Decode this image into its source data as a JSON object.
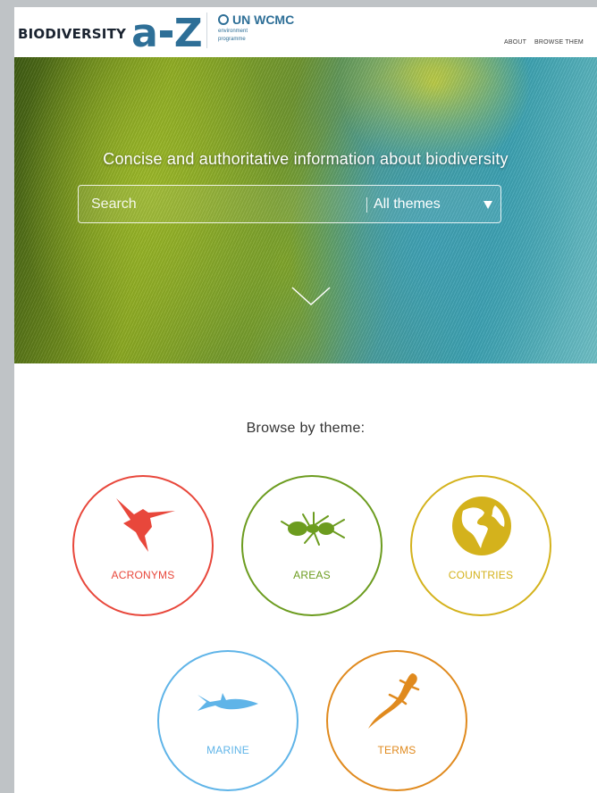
{
  "header": {
    "logo_text": "BIODIVERSITY",
    "logo_a": "a",
    "logo_z": "Z",
    "partner_name": "UN WCMC",
    "partner_sub1": "environment",
    "partner_sub2": "programme",
    "nav": [
      {
        "label": "ABOUT"
      },
      {
        "label": "BROWSE THEM"
      }
    ]
  },
  "hero": {
    "title": "Concise and authoritative information about biodiversity",
    "search": {
      "placeholder": "Search",
      "value": ""
    },
    "theme_select": {
      "selected": "All themes"
    }
  },
  "browse": {
    "title": "Browse by theme:",
    "themes": [
      {
        "label": "ACRONYMS",
        "icon": "hummingbird-icon",
        "color": "#e8473b"
      },
      {
        "label": "AREAS",
        "icon": "ant-icon",
        "color": "#6c9c1f"
      },
      {
        "label": "COUNTRIES",
        "icon": "globe-icon",
        "color": "#d4b21c"
      },
      {
        "label": "MARINE",
        "icon": "shark-icon",
        "color": "#5fb4e8"
      },
      {
        "label": "TERMS",
        "icon": "lizard-icon",
        "color": "#e08a1e"
      }
    ]
  },
  "colors": {
    "brand_blue": "#2e6f97"
  }
}
